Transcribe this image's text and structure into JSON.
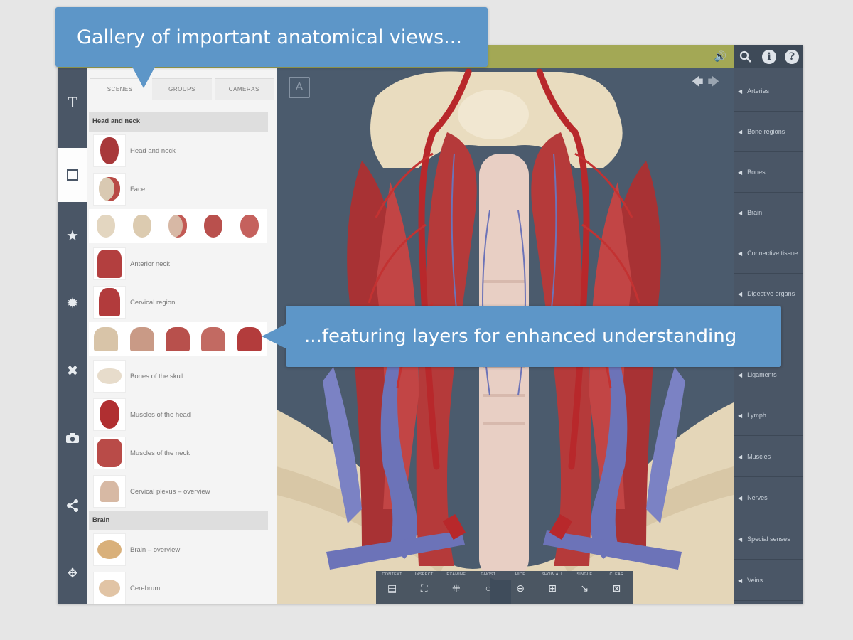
{
  "callouts": {
    "gallery": "Gallery of important anatomical views...",
    "layers": "...featuring layers for enhanced understanding"
  },
  "rail": {
    "icons": [
      "text-icon",
      "square-icon",
      "star-icon",
      "gear-icon",
      "tools-icon",
      "camera-icon",
      "share-icon",
      "move-icon"
    ],
    "text_label": "T"
  },
  "panel": {
    "tabs": [
      "SCENES",
      "GROUPS",
      "CAMERAS"
    ],
    "active_tab": "SCENES",
    "sections": [
      {
        "title": "Head and neck",
        "items": [
          "Head and neck",
          "Face",
          "Anterior neck",
          "Cervical region",
          "Bones of the skull",
          "Muscles of the head",
          "Muscles of the neck",
          "Cervical plexus – overview"
        ]
      },
      {
        "title": "Brain",
        "items": [
          "Brain – overview",
          "Cerebrum"
        ]
      }
    ]
  },
  "viewport": {
    "a_button": "A"
  },
  "right_list": [
    "Arteries",
    "Bone regions",
    "Bones",
    "Brain",
    "Connective tissue",
    "Digestive organs",
    "Ligaments",
    "Lymph",
    "Muscles",
    "Nerves",
    "Special senses",
    "Veins"
  ],
  "toolbar": [
    "CONTEXT",
    "INSPECT",
    "EXAMINE",
    "GHOST",
    "HIDE",
    "SHOW ALL",
    "SINGLE",
    "CLEAR"
  ],
  "colors": {
    "topbar": "#a3a855",
    "sidebar": "#4a5666",
    "callout": "#5d96c8",
    "viewport": "#4b5b6d",
    "artery": "#b8282b",
    "vein": "#6c73b8",
    "bone": "#e9dcbf"
  }
}
